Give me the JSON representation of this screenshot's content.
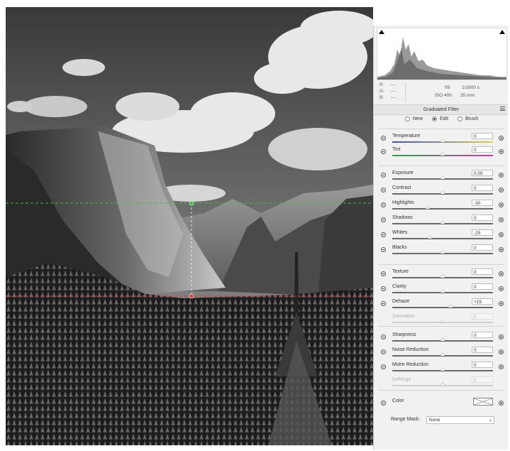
{
  "photo": {
    "description_icon": "landscape-photo",
    "guide_top_color": "#3fbf3f",
    "guide_bottom_color": "#d23a3a"
  },
  "histogram": {
    "icon_left": "shadow-clipping-icon",
    "icon_right": "highlight-clipping-icon"
  },
  "readout": {
    "r_label": "R:",
    "g_label": "G:",
    "b_label": "B:",
    "r_value": "---",
    "g_value": "---",
    "b_value": "---",
    "aperture": "f/8",
    "shutter": "1/1600 s",
    "iso": "ISO 400",
    "focal": "35 mm"
  },
  "panel": {
    "title": "Graduated Filter",
    "menu_icon": "panel-menu-icon"
  },
  "modes": [
    {
      "label": "New",
      "selected": false
    },
    {
      "label": "Edit",
      "selected": true
    },
    {
      "label": "Brush",
      "selected": false
    }
  ],
  "sliders": [
    {
      "key": "temperature",
      "label": "Temperature",
      "value": "0",
      "pos": 0.5,
      "track": "temp",
      "enabled": true
    },
    {
      "key": "tint",
      "label": "Tint",
      "value": "0",
      "pos": 0.5,
      "track": "tint",
      "enabled": true
    },
    {
      "key": "exposure",
      "label": "Exposure",
      "value": "0.00",
      "pos": 0.5,
      "enabled": true
    },
    {
      "key": "contrast",
      "label": "Contrast",
      "value": "0",
      "pos": 0.5,
      "enabled": true
    },
    {
      "key": "highlights",
      "label": "Highlights",
      "value": "-30",
      "pos": 0.35,
      "enabled": true
    },
    {
      "key": "shadows",
      "label": "Shadows",
      "value": "0",
      "pos": 0.5,
      "enabled": true
    },
    {
      "key": "whites",
      "label": "Whites",
      "value": "-25",
      "pos": 0.375,
      "enabled": true
    },
    {
      "key": "blacks",
      "label": "Blacks",
      "value": "0",
      "pos": 0.5,
      "enabled": true
    },
    {
      "key": "texture",
      "label": "Texture",
      "value": "0",
      "pos": 0.5,
      "enabled": true
    },
    {
      "key": "clarity",
      "label": "Clarity",
      "value": "0",
      "pos": 0.5,
      "enabled": true
    },
    {
      "key": "dehaze",
      "label": "Dehaze",
      "value": "+15",
      "pos": 0.575,
      "enabled": true
    },
    {
      "key": "saturation",
      "label": "Saturation",
      "value": "0",
      "pos": 0.5,
      "enabled": false
    },
    {
      "key": "sharpness",
      "label": "Sharpness",
      "value": "0",
      "pos": 0.5,
      "enabled": true
    },
    {
      "key": "noise_reduction",
      "label": "Noise Reduction",
      "value": "0",
      "pos": 0.5,
      "enabled": true
    },
    {
      "key": "moire_reduction",
      "label": "Moire Reduction",
      "value": "0",
      "pos": 0.5,
      "enabled": true
    },
    {
      "key": "defringe",
      "label": "Defringe",
      "value": "0",
      "pos": 0.5,
      "enabled": false
    }
  ],
  "color": {
    "label": "Color",
    "swatch_icon": "no-color-swatch-icon"
  },
  "range_mask": {
    "label": "Range Mask:",
    "value": "None"
  }
}
